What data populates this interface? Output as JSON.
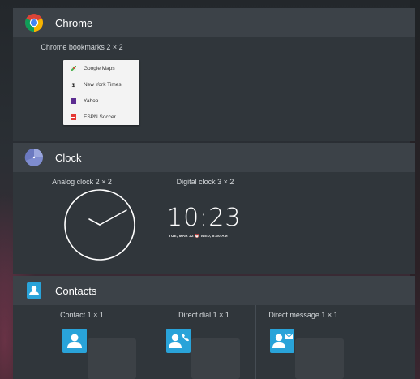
{
  "sections": {
    "chrome": {
      "title": "Chrome",
      "icon": "chrome-logo-icon",
      "widgets": [
        {
          "label": "Chrome bookmarks",
          "size": "2 × 2",
          "bookmarks": [
            {
              "label": "Google Maps",
              "icon": "google-maps-favicon-icon",
              "color": "#4caf50"
            },
            {
              "label": "New York Times",
              "icon": "nyt-favicon-icon",
              "color": "#222222"
            },
            {
              "label": "Yahoo",
              "icon": "yahoo-favicon-icon",
              "color": "#5c2d91"
            },
            {
              "label": "ESPN Soccer",
              "icon": "espn-favicon-icon",
              "color": "#e53935"
            }
          ]
        }
      ]
    },
    "clock": {
      "title": "Clock",
      "icon": "clock-app-icon",
      "widgets": [
        {
          "label": "Analog clock",
          "size": "2 × 2"
        },
        {
          "label": "Digital clock",
          "size": "3 × 2",
          "time": "10:23",
          "subline": "TUE, MAR 22 ⏰ WED, 8:30 AM"
        }
      ]
    },
    "contacts": {
      "title": "Contacts",
      "icon": "contacts-app-icon",
      "widgets": [
        {
          "label": "Contact",
          "size": "1 × 1",
          "icon": "contact-person-icon"
        },
        {
          "label": "Direct dial",
          "size": "1 × 1",
          "icon": "direct-dial-icon"
        },
        {
          "label": "Direct message",
          "size": "1 × 1",
          "icon": "direct-message-icon"
        }
      ]
    }
  },
  "colors": {
    "header_bg": "#3c4248",
    "body_bg": "#30363b",
    "contact_accent": "#29a3d9"
  }
}
